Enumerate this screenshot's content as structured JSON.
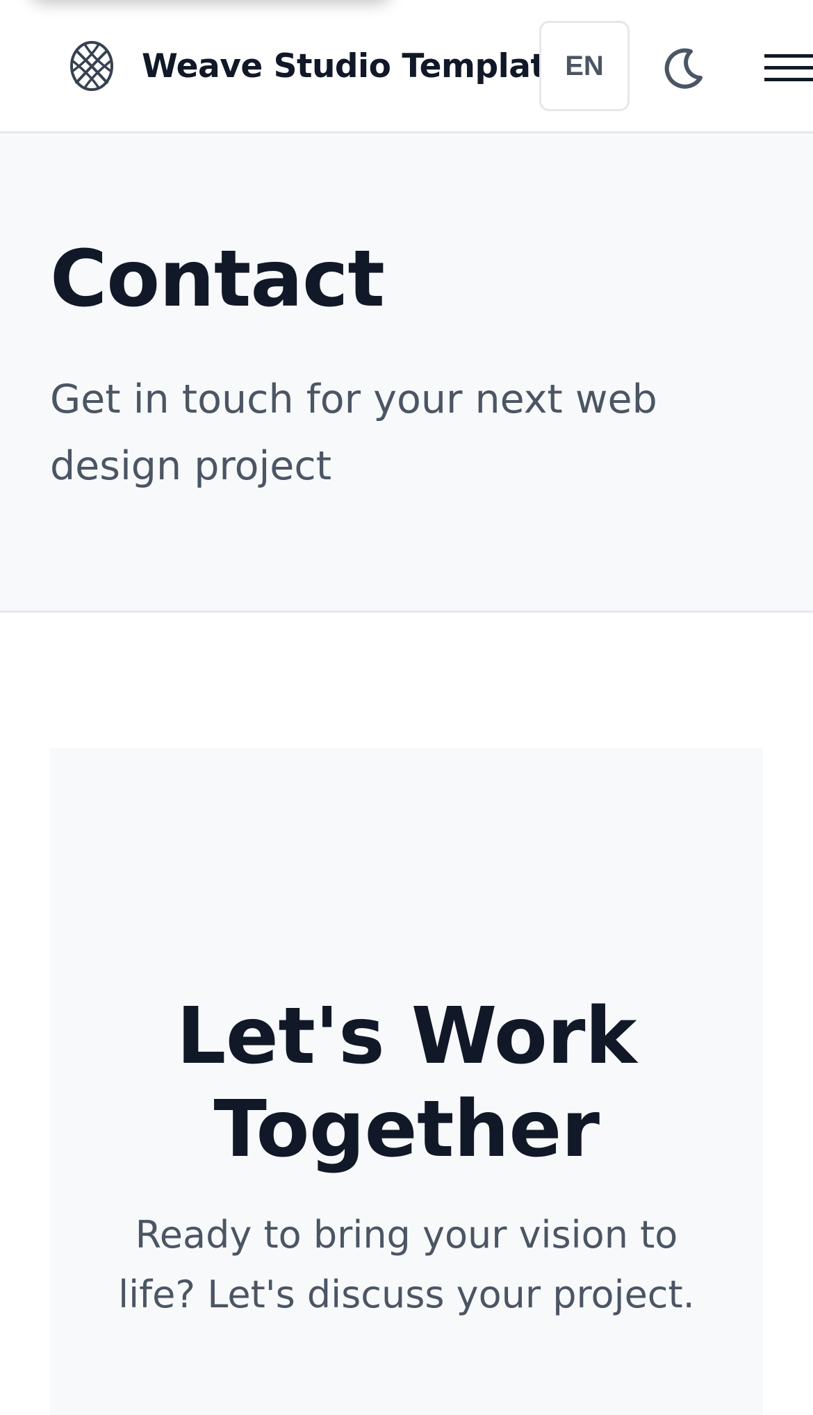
{
  "header": {
    "site_title": "Weave Studio Template",
    "language_label": "EN",
    "logo_icon": "weave-logo-icon",
    "theme_icon": "moon-icon",
    "menu_icon": "hamburger-menu-icon"
  },
  "hero": {
    "title": "Contact",
    "subtitle": "Get in touch for your next web design project"
  },
  "cta": {
    "title": "Let's Work Together",
    "text": "Ready to bring your vision to life? Let's discuss your project."
  },
  "colors": {
    "text_primary": "#111827",
    "text_secondary": "#4b5563",
    "hero_background": "#f8f9fb",
    "border": "#e5e7eb"
  }
}
